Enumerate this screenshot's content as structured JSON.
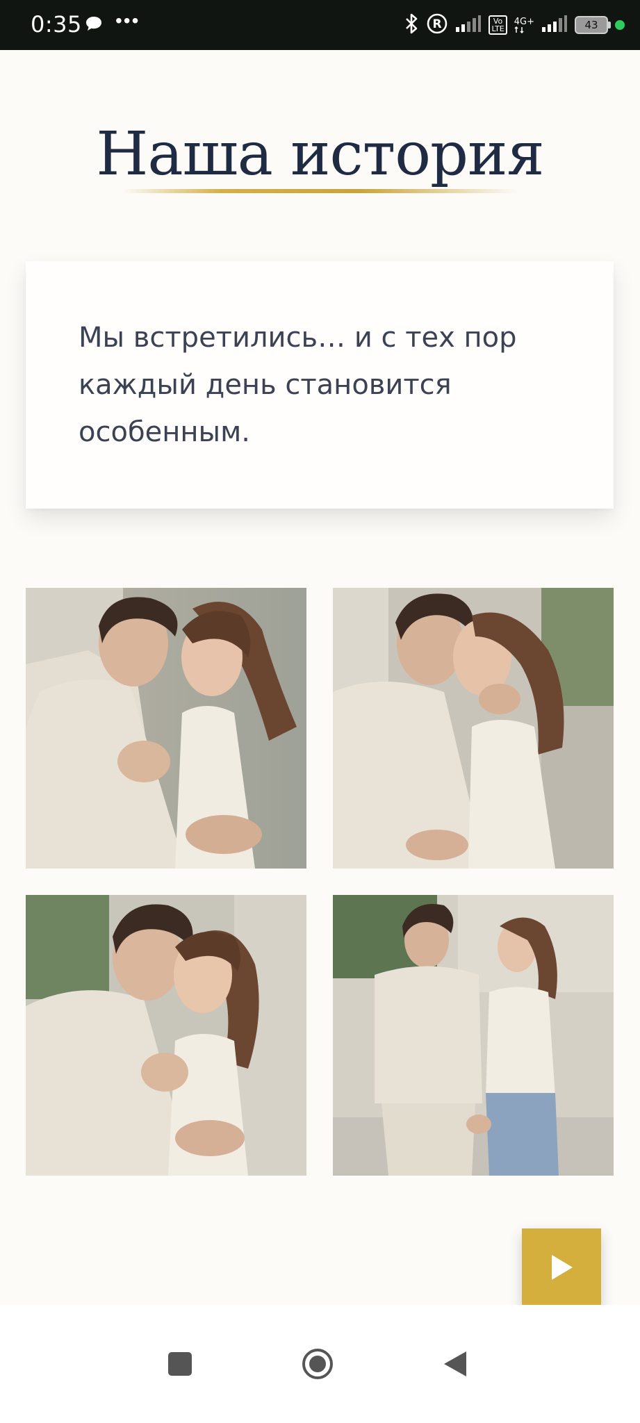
{
  "status_bar": {
    "time": "0:35",
    "icons": [
      "chat-bubble-icon",
      "more-dots-icon",
      "bluetooth-icon",
      "registered-icon",
      "signal-icon",
      "volte-icon",
      "4g-plus-icon",
      "signal-icon",
      "battery-icon"
    ],
    "volte_label": "Vo\nLTE",
    "network_label": "4G+",
    "battery_level": "43",
    "dot_color": "#2ecc5f"
  },
  "page": {
    "title": "Наша история",
    "story_text": "Мы встретились… и с тех пор каждый день становится особенным.",
    "accent_color": "#d4af3e",
    "title_color": "#1f2b43"
  },
  "gallery": {
    "photos": [
      {
        "subject": "couple-forehead-touch"
      },
      {
        "subject": "couple-kiss"
      },
      {
        "subject": "couple-embrace-smiling"
      },
      {
        "subject": "couple-walking-holding-hands"
      }
    ]
  },
  "controls": {
    "play_button_icon": "play-icon"
  },
  "nav_bar": {
    "buttons": [
      "recents-square-icon",
      "home-circle-icon",
      "back-triangle-icon"
    ]
  }
}
